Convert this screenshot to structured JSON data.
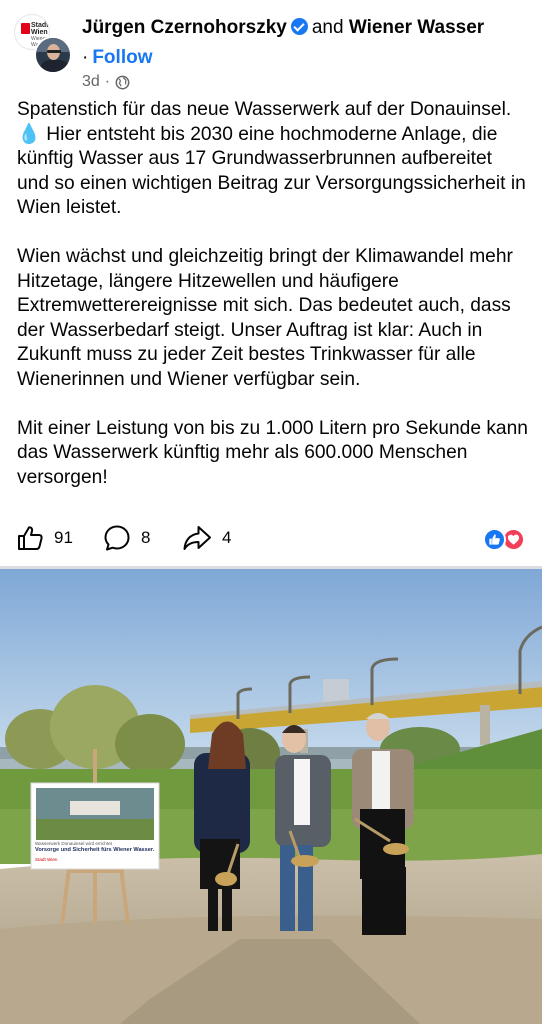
{
  "post": {
    "author": "Jürgen Czernohorszky",
    "connector": "and",
    "coauthor": "Wiener Wasser",
    "follow_label": "Follow",
    "separator": "·",
    "timestamp": "3d",
    "privacy_icon": "globe-icon",
    "logo_text": "Stadt Wien",
    "logo_subtext": "Wiener Wasser",
    "paragraphs": [
      {
        "before_emoji": "Spatenstich für das neue Wasserwerk auf der Donauinsel. ",
        "emoji": "💧",
        "after_emoji": " Hier entsteht bis 2030 eine hochmoderne Anlage, die künftig Wasser aus 17 Grundwasserbrunnen aufbereitet und so einen wichtigen Beitrag zur Versorgungssicherheit in Wien leistet."
      },
      {
        "text": "Wien wächst und gleichzeitig bringt der Klimawandel mehr Hitzetage, längere Hitzewellen und häufigere Extremwetterereignisse mit sich. Das bedeutet auch, dass der Wasserbedarf steigt. Unser Auftrag ist klar: Auch in Zukunft muss zu jeder Zeit bestes Trinkwasser für alle Wienerinnen und Wiener verfügbar sein."
      },
      {
        "text": "Mit einer Leistung von bis zu 1.000 Litern pro Sekunde kann das Wasserwerk künftig mehr als 600.000 Menschen versorgen!"
      }
    ]
  },
  "actions": {
    "likes": "91",
    "comments": "8",
    "shares": "4",
    "reactions": [
      "like",
      "love"
    ]
  },
  "photo": {
    "sign_small_text": "Wasserwerk Donauinsel wird errichtet",
    "sign_headline": "Vorsorge und Sicherheit fürs Wiener Wasser.",
    "sign_logo": "Stadt Wien"
  },
  "colors": {
    "accent": "#1877f2",
    "love": "#f33e58",
    "text": "#050505",
    "muted": "#65676b"
  }
}
